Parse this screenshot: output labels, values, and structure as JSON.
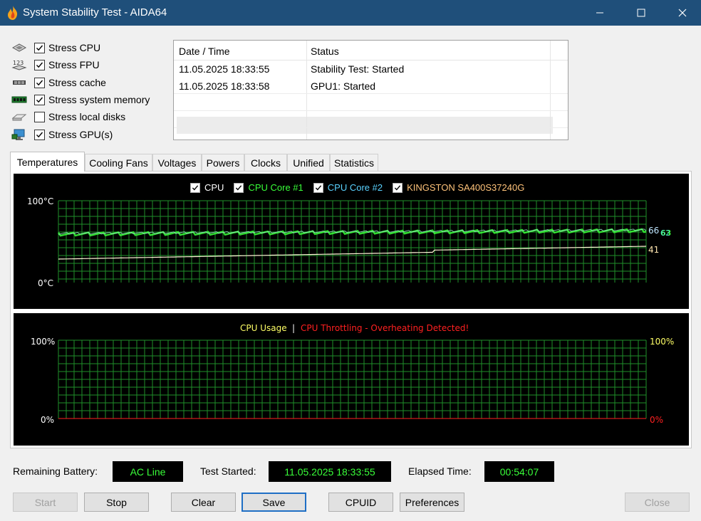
{
  "window": {
    "title": "System Stability Test - AIDA64"
  },
  "stress_options": [
    {
      "label": "Stress CPU",
      "checked": true,
      "icon": "cpu-chip-icon"
    },
    {
      "label": "Stress FPU",
      "checked": true,
      "icon": "fpu-123-icon"
    },
    {
      "label": "Stress cache",
      "checked": true,
      "icon": "cache-chip-icon"
    },
    {
      "label": "Stress system memory",
      "checked": true,
      "icon": "memory-module-icon"
    },
    {
      "label": "Stress local disks",
      "checked": false,
      "icon": "hard-disk-icon"
    },
    {
      "label": "Stress GPU(s)",
      "checked": true,
      "icon": "gpu-monitor-icon"
    }
  ],
  "log": {
    "columns": [
      "Date / Time",
      "Status"
    ],
    "rows": [
      [
        "11.05.2025 18:33:55",
        "Stability Test: Started"
      ],
      [
        "11.05.2025 18:33:58",
        "GPU1: Started"
      ]
    ]
  },
  "tabs": [
    "Temperatures",
    "Cooling Fans",
    "Voltages",
    "Powers",
    "Clocks",
    "Unified",
    "Statistics"
  ],
  "temp_graph": {
    "legend": [
      {
        "label": "CPU",
        "color": "#ffffff"
      },
      {
        "label": "CPU Core #1",
        "color": "#39ff39"
      },
      {
        "label": "CPU Core #2",
        "color": "#5ad2ff"
      },
      {
        "label": "KINGSTON SA400S37240G",
        "color": "#ffc37a"
      }
    ],
    "y_max_label": "100°C",
    "y_min_label": "0°C",
    "readouts": {
      "core2": "66",
      "core1": "63",
      "cpu": "62",
      "disk": "41"
    }
  },
  "usage_graph": {
    "legend_usage": "CPU Usage",
    "separator": "|",
    "legend_throttle": "CPU Throttling - Overheating Detected!",
    "left_max": "100%",
    "left_min": "0%",
    "right_max": "100%",
    "right_min": "0%"
  },
  "status": {
    "battery_label": "Remaining Battery:",
    "battery_value": "AC Line",
    "started_label": "Test Started:",
    "started_value": "11.05.2025 18:33:55",
    "elapsed_label": "Elapsed Time:",
    "elapsed_value": "00:54:07"
  },
  "buttons": {
    "start": "Start",
    "stop": "Stop",
    "clear": "Clear",
    "save": "Save",
    "cpuid": "CPUID",
    "preferences": "Preferences",
    "close": "Close"
  },
  "colors": {
    "titlebar": "#1f4f7a",
    "grid": "#1f8f2a",
    "core1": "#39ff39",
    "core2": "#5ad2ff",
    "disk": "#ffc37a",
    "usage": "#ffff66",
    "throttle": "#ff2020"
  }
}
